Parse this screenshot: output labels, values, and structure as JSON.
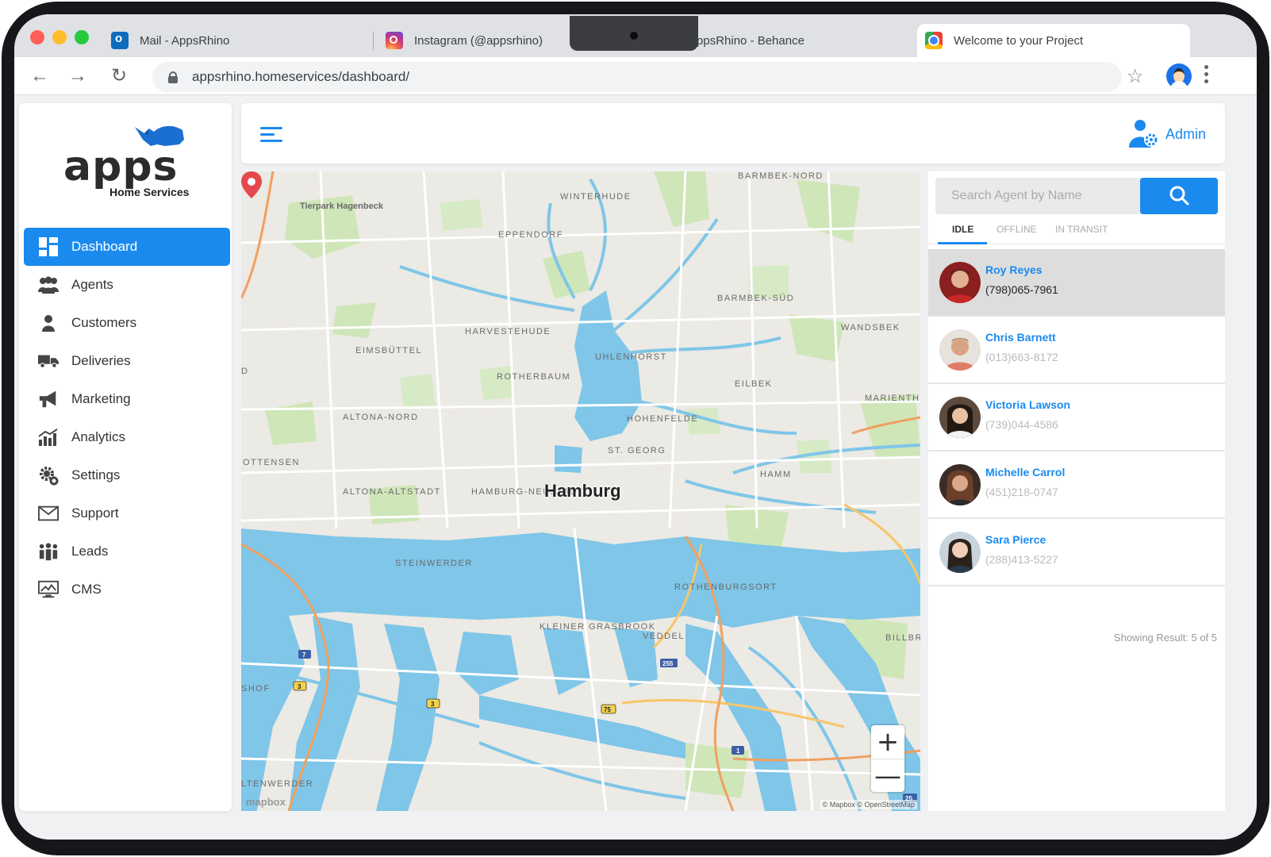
{
  "browser": {
    "tabs": [
      {
        "title": "Mail - AppsRhino",
        "icon": "outlook-icon"
      },
      {
        "title": "Instagram (@appsrhino)",
        "icon": "instagram-icon"
      },
      {
        "title": "AppsRhino - Behance",
        "icon": "behance-icon"
      },
      {
        "title": "Welcome to your Project",
        "icon": "chrome-icon",
        "active": true
      }
    ],
    "url": "appsrhino.homeservices/dashboard/"
  },
  "logo": {
    "word": "apps",
    "sub": "Home Services"
  },
  "sidebar": {
    "items": [
      {
        "label": "Dashboard",
        "icon": "dashboard-icon",
        "active": true
      },
      {
        "label": "Agents",
        "icon": "agents-icon"
      },
      {
        "label": "Customers",
        "icon": "customer-icon"
      },
      {
        "label": "Deliveries",
        "icon": "truck-icon"
      },
      {
        "label": "Marketing",
        "icon": "megaphone-icon"
      },
      {
        "label": "Analytics",
        "icon": "chart-icon"
      },
      {
        "label": "Settings",
        "icon": "gear-icon"
      },
      {
        "label": "Support",
        "icon": "mail-icon"
      },
      {
        "label": "Leads",
        "icon": "group-icon"
      },
      {
        "label": "CMS",
        "icon": "monitor-icon"
      }
    ]
  },
  "header": {
    "user": "Admin"
  },
  "map": {
    "city": "Hamburg",
    "districts": [
      "BARMBEK-NORD",
      "WINTERHUDE",
      "Tierpark Hagenbeck",
      "EPPENDORF",
      "BARMBEK-SÜD",
      "HARVESTEHUDE",
      "WANDSBEK",
      "EIMSBÜTTEL",
      "UHLENHORST",
      "ROTHERBAUM",
      "EILBEK",
      "MARIENTHA",
      "ALTONA-NORD",
      "HOHENFELDE",
      "ST. GEORG",
      "OTTENSEN",
      "HAMM",
      "ALTONA-ALTSTADT",
      "HAMBURG-NEUSTADT",
      "STEINWERDER",
      "ROTHENBURGSORT",
      "KLEINER GRASBROOK",
      "VEDDEL",
      "BILLBR",
      "SHOF",
      "LTENWERDER",
      "D"
    ],
    "road_shields": [
      "7",
      "3",
      "3",
      "255",
      "75",
      "1",
      "25"
    ],
    "brand": "mapbox",
    "attribution": "© Mapbox © OpenStreetMap",
    "zoom_in": "+",
    "zoom_out": "—"
  },
  "panel": {
    "search_placeholder": "Search Agent by Name",
    "tabs": [
      "IDLE",
      "OFFLINE",
      "IN TRANSIT"
    ],
    "agents": [
      {
        "name": "Roy Reyes",
        "phone": "(798)065-7961",
        "selected": true
      },
      {
        "name": "Chris Barnett",
        "phone": "(013)663-8172"
      },
      {
        "name": "Victoria Lawson",
        "phone": "(739)044-4586"
      },
      {
        "name": "Michelle Carrol",
        "phone": "(451)218-0747"
      },
      {
        "name": "Sara Pierce",
        "phone": "(288)413-5227"
      }
    ],
    "result": "Showing Result: 5 of 5"
  }
}
